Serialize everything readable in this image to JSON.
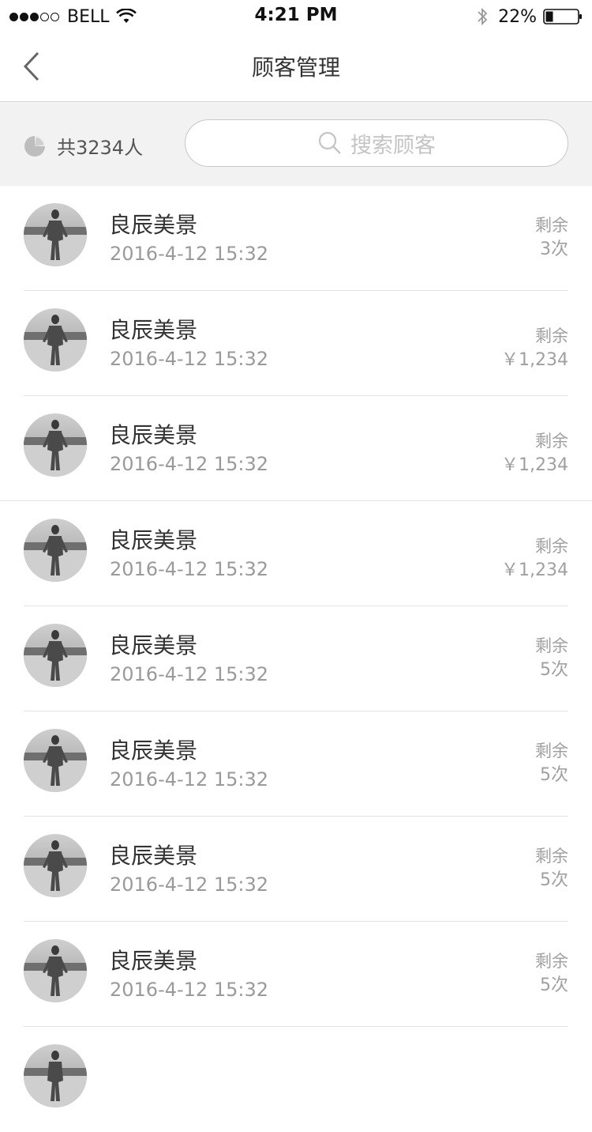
{
  "status_bar": {
    "carrier": "BELL",
    "time": "4:21 PM",
    "battery": "22%"
  },
  "nav": {
    "title": "顾客管理"
  },
  "summary": {
    "count_text": "共3234人",
    "search_placeholder": "搜索顾客"
  },
  "customers": [
    {
      "name": "良辰美景",
      "date": "2016-4-12 15:32",
      "remain_label": "剩余",
      "remain_value": "3次"
    },
    {
      "name": "良辰美景",
      "date": "2016-4-12 15:32",
      "remain_label": "剩余",
      "remain_value": "￥1,234"
    },
    {
      "name": "良辰美景",
      "date": "2016-4-12 15:32",
      "remain_label": "剩余",
      "remain_value": "￥1,234"
    },
    {
      "name": "良辰美景",
      "date": "2016-4-12 15:32",
      "remain_label": "剩余",
      "remain_value": "￥1,234"
    },
    {
      "name": "良辰美景",
      "date": "2016-4-12 15:32",
      "remain_label": "剩余",
      "remain_value": "5次"
    },
    {
      "name": "良辰美景",
      "date": "2016-4-12 15:32",
      "remain_label": "剩余",
      "remain_value": "5次"
    },
    {
      "name": "良辰美景",
      "date": "2016-4-12 15:32",
      "remain_label": "剩余",
      "remain_value": "5次"
    },
    {
      "name": "良辰美景",
      "date": "2016-4-12 15:32",
      "remain_label": "剩余",
      "remain_value": "5次"
    }
  ],
  "icons": {
    "back": "chevron-left-icon",
    "count": "pie-chart-icon",
    "search": "search-icon",
    "wifi": "wifi-icon",
    "bluetooth": "bluetooth-icon",
    "battery": "battery-icon"
  }
}
